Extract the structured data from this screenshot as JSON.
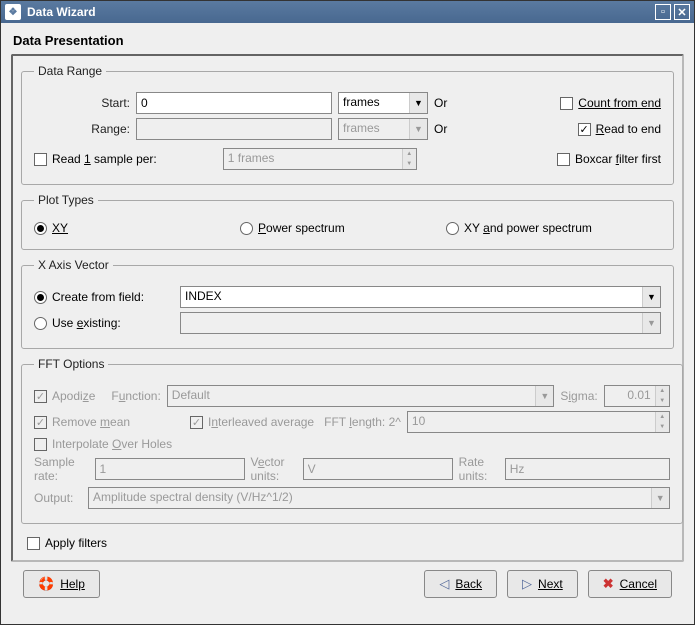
{
  "window": {
    "title": "Data Wizard"
  },
  "page_title": "Data Presentation",
  "data_range": {
    "legend": "Data Range",
    "start_label": "Start:",
    "start_value": "0",
    "start_unit": "frames",
    "or": "Or",
    "count_from_end_label": "Count from end",
    "count_from_end_checked": false,
    "range_label": "Range:",
    "range_value": "",
    "range_unit": "frames",
    "read_to_end_label": "Read to end",
    "read_to_end_checked": true,
    "read_sample_label_pre": "Read ",
    "read_sample_label_mid": "1",
    "read_sample_label_post": " sample per:",
    "read_sample_checked": false,
    "read_sample_value": "1 frames",
    "boxcar_label_pre": "Boxcar ",
    "boxcar_label_mid": "f",
    "boxcar_label_post": "ilter first",
    "boxcar_checked": false
  },
  "plot_types": {
    "legend": "Plot Types",
    "xy_label": "XY",
    "power_label_pre": "P",
    "power_label_post": "ower spectrum",
    "both_label_pre": "XY ",
    "both_label_mid": "a",
    "both_label_post": "nd power spectrum",
    "selected": "xy"
  },
  "x_axis": {
    "legend": "X Axis Vector",
    "create_label": "Create from field:",
    "create_value": "INDEX",
    "existing_label_pre": "Use ",
    "existing_label_mid": "e",
    "existing_label_post": "xisting:",
    "existing_value": "",
    "selected": "create"
  },
  "fft": {
    "legend": "FFT Options",
    "apodize_label_pre": "Apodi",
    "apodize_label_mid": "z",
    "apodize_label_post": "e",
    "apodize_checked": true,
    "function_label_pre": "F",
    "function_label_mid": "u",
    "function_label_post": "nction:",
    "function_value": "Default",
    "sigma_label_pre": "S",
    "sigma_label_mid": "i",
    "sigma_label_post": "gma:",
    "sigma_value": "0.01",
    "remove_mean_label_pre": "Remove ",
    "remove_mean_label_mid": "m",
    "remove_mean_label_post": "ean",
    "remove_mean_checked": true,
    "interleaved_label_pre": "I",
    "interleaved_label_mid": "n",
    "interleaved_label_post": "terleaved average",
    "interleaved_checked": true,
    "fft_length_label_pre": "FFT ",
    "fft_length_label_mid": "l",
    "fft_length_label_post": "ength: 2^",
    "fft_length_value": "10",
    "interpolate_label_pre": "Interpolate ",
    "interpolate_label_mid": "O",
    "interpolate_label_post": "ver Holes",
    "interpolate_checked": false,
    "sample_rate_label": "Sample rate:",
    "sample_rate_value": "1",
    "vector_units_label_pre": "V",
    "vector_units_label_mid": "e",
    "vector_units_label_post": "ctor units:",
    "vector_units_value": "V",
    "rate_units_label": "Rate units:",
    "rate_units_value": "Hz",
    "output_label": "Output:",
    "output_value": "Amplitude spectral density (V/Hz^1/2)"
  },
  "apply_filters": {
    "label": "Apply filters",
    "checked": false
  },
  "buttons": {
    "help": "Help",
    "back": "Back",
    "next": "Next",
    "cancel": "Cancel"
  }
}
